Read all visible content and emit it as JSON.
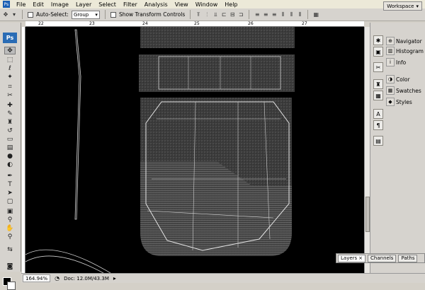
{
  "menubar": {
    "items": [
      "File",
      "Edit",
      "Image",
      "Layer",
      "Select",
      "Filter",
      "Analysis",
      "View",
      "Window",
      "Help"
    ]
  },
  "options": {
    "auto_select_label": "Auto-Select:",
    "auto_select_value": "Group",
    "show_transform_label": "Show Transform Controls",
    "workspace_label": "Workspace"
  },
  "toolbox": {
    "logo": "Ps"
  },
  "rulers": {
    "top_numbers": [
      "22",
      "23",
      "24",
      "25",
      "26",
      "27"
    ]
  },
  "status": {
    "zoom": "164.94%",
    "doc": "Doc: 12.0M/43.3M"
  },
  "dock": {
    "panels": [
      "Navigator",
      "Histogram",
      "Info",
      "Color",
      "Swatches",
      "Styles"
    ]
  },
  "layers_panel": {
    "tabs": [
      "Layers",
      "Channels",
      "Paths"
    ]
  },
  "colors": {
    "chrome": "#d6d3ce",
    "canvas": "#000000",
    "texture": "#3b3b3b"
  }
}
